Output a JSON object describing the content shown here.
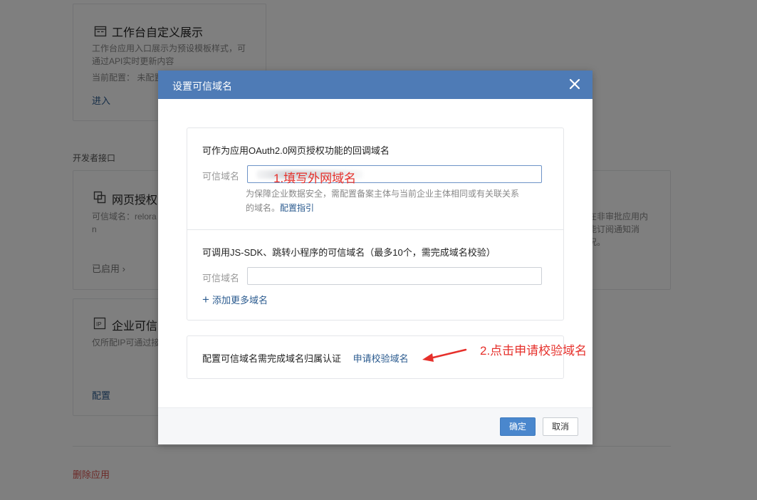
{
  "background": {
    "workbench_card": {
      "title": "工作台自定义展示",
      "desc_line1": "工作台应用入口展示为预设模板样式，可",
      "desc_line2": "通过API实时更新内容",
      "current_config": "当前配置：  未配置",
      "enter_link": "进入"
    },
    "section_label": "开发者接口",
    "web_auth_card": {
      "title": "网页授权",
      "desc_line1": "可信域名：relora",
      "desc_line2": "n",
      "status": "已启用 ›"
    },
    "ip_card": {
      "title": "企业可信",
      "desc": "仅所配IP可通过接",
      "link": "配置"
    },
    "right_card": {
      "line1": "在非审批应用内",
      "line2": "能订阅通知消",
      "line3": "况。"
    },
    "delete_app": "删除应用"
  },
  "modal": {
    "title": "设置可信域名",
    "close_icon": "close-icon",
    "oauth_section": {
      "heading": "可作为应用OAuth2.0网页授权功能的回调域名",
      "label": "可信域名",
      "hint_line1": "为保障企业数据安全，需配置备案主体与当前企业主体相同或有关联关系",
      "hint_line2": "的域名。",
      "hint_link": "配置指引"
    },
    "jssdk_section": {
      "heading": "可调用JS-SDK、跳转小程序的可信域名（最多10个，需完成域名校验）",
      "label": "可信域名",
      "value": "",
      "add_more": "添加更多域名"
    },
    "verify_section": {
      "text": "配置可信域名需完成域名归属认证",
      "link": "申请校验域名"
    },
    "footer": {
      "confirm": "确定",
      "cancel": "取消"
    }
  },
  "annotations": {
    "step1": "1.填写外网域名",
    "step2": "2.点击申请校验域名"
  },
  "colors": {
    "header_blue": "#4e7bb6",
    "link_blue": "#2b5b8f",
    "primary_button": "#4a87cd",
    "annotation_red": "#e6302b",
    "danger_red": "#d9534f"
  }
}
